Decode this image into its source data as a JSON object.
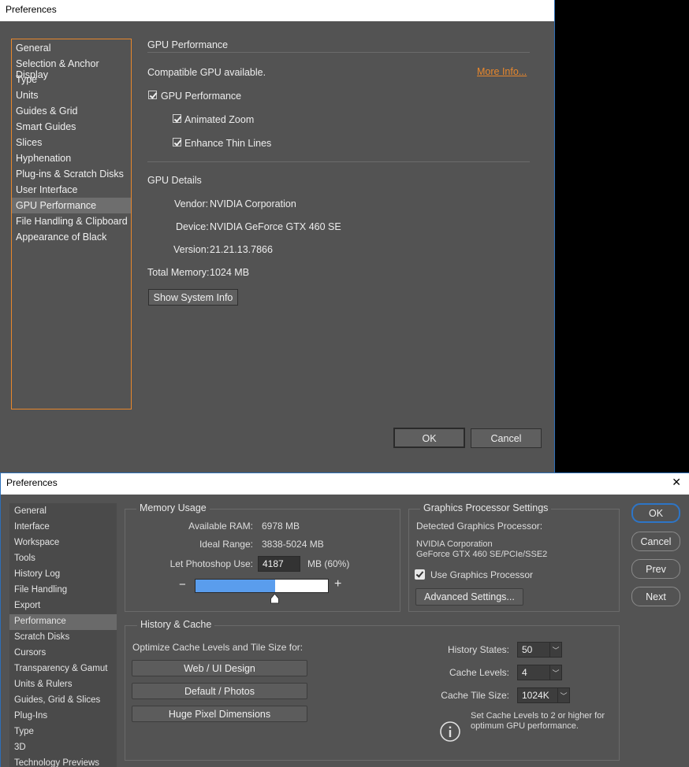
{
  "illustrator": {
    "title": "Preferences",
    "sidebar": [
      "General",
      "Selection & Anchor Display",
      "Type",
      "Units",
      "Guides & Grid",
      "Smart Guides",
      "Slices",
      "Hyphenation",
      "Plug-ins & Scratch Disks",
      "User Interface",
      "GPU Performance",
      "File Handling & Clipboard",
      "Appearance of Black"
    ],
    "selected_index": 10,
    "section_title": "GPU Performance",
    "compatible_text": "Compatible GPU available.",
    "more_info": "More Info...",
    "gpu_perf_label": "GPU Performance",
    "gpu_perf_checked": true,
    "animated_zoom_label": "Animated Zoom",
    "animated_zoom_checked": true,
    "thin_lines_label": "Enhance Thin Lines",
    "thin_lines_checked": true,
    "details_title": "GPU Details",
    "vendor_label": "Vendor:",
    "vendor_value": "NVIDIA Corporation",
    "device_label": "Device:",
    "device_value": "NVIDIA GeForce GTX 460 SE",
    "version_label": "Version:",
    "version_value": "21.21.13.7866",
    "memory_label": "Total Memory:",
    "memory_value": "1024 MB",
    "sysinfo_button": "Show System Info",
    "ok": "OK",
    "cancel": "Cancel",
    "accent": "#e8872c"
  },
  "photoshop": {
    "title": "Preferences",
    "close": "✕",
    "sidebar": [
      "General",
      "Interface",
      "Workspace",
      "Tools",
      "History Log",
      "File Handling",
      "Export",
      "Performance",
      "Scratch Disks",
      "Cursors",
      "Transparency & Gamut",
      "Units & Rulers",
      "Guides, Grid & Slices",
      "Plug-Ins",
      "Type",
      "3D",
      "Technology Previews"
    ],
    "selected_index": 7,
    "memory": {
      "title": "Memory Usage",
      "available_label": "Available RAM:",
      "available_value": "6978 MB",
      "ideal_label": "Ideal Range:",
      "ideal_value": "3838-5024 MB",
      "let_label": "Let Photoshop Use:",
      "let_value": "4187",
      "unit": "MB (60%)",
      "minus": "−",
      "plus": "+",
      "slider_fraction": 0.6
    },
    "gpu": {
      "title": "Graphics Processor Settings",
      "detected_label": "Detected Graphics Processor:",
      "line1": "NVIDIA Corporation",
      "line2": "GeForce GTX 460 SE/PCIe/SSE2",
      "use_label": "Use Graphics Processor",
      "use_checked": true,
      "advanced_button": "Advanced Settings..."
    },
    "history": {
      "title": "History & Cache",
      "optimize_label": "Optimize Cache Levels and Tile Size for:",
      "btn_web": "Web / UI Design",
      "btn_default": "Default / Photos",
      "btn_huge": "Huge Pixel Dimensions",
      "states_label": "History States:",
      "states_value": "50",
      "levels_label": "Cache Levels:",
      "levels_value": "4",
      "tile_label": "Cache Tile Size:",
      "tile_value": "1024K",
      "info_text_1": "Set Cache Levels to 2 or higher for",
      "info_text_2": "optimum GPU performance."
    },
    "buttons": {
      "ok": "OK",
      "cancel": "Cancel",
      "prev": "Prev",
      "next": "Next"
    },
    "accent": "#5a9ded"
  }
}
